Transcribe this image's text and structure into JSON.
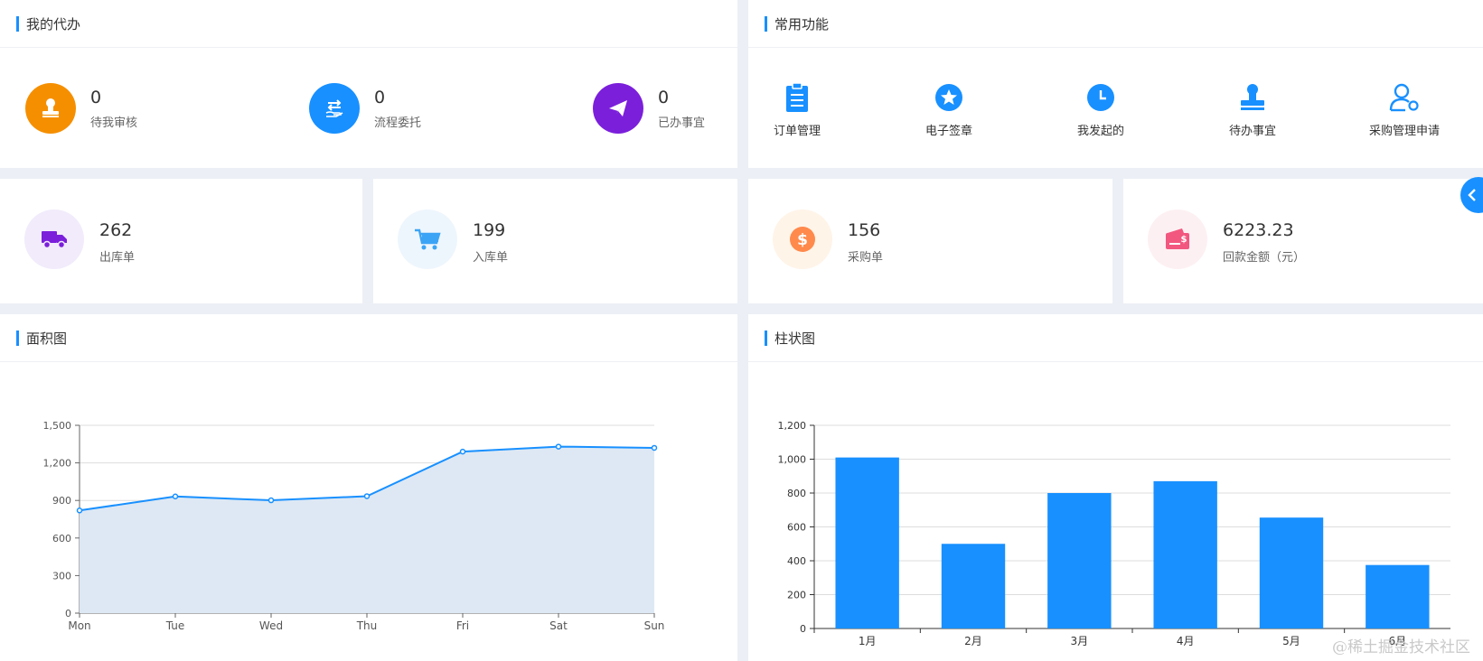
{
  "todo": {
    "title": "我的代办",
    "items": [
      {
        "count": "0",
        "label": "待我审核",
        "icon": "stamp-icon",
        "color": "#f58f00"
      },
      {
        "count": "0",
        "label": "流程委托",
        "icon": "hand-transfer-icon",
        "color": "#1890ff"
      },
      {
        "count": "0",
        "label": "已办事宜",
        "icon": "paper-plane-icon",
        "color": "#7b1fdb"
      }
    ]
  },
  "common": {
    "title": "常用功能",
    "items": [
      {
        "label": "订单管理",
        "icon": "clipboard-icon"
      },
      {
        "label": "电子签章",
        "icon": "star-badge-icon"
      },
      {
        "label": "我发起的",
        "icon": "clock-icon"
      },
      {
        "label": "待办事宜",
        "icon": "stamp-icon"
      },
      {
        "label": "采购管理申请",
        "icon": "user-settings-icon"
      }
    ]
  },
  "stats": [
    {
      "value": "262",
      "label": "出库单",
      "icon": "truck-icon",
      "color": "#7b1fdb",
      "bg": "#f1ebfb"
    },
    {
      "value": "199",
      "label": "入库单",
      "icon": "cart-icon",
      "color": "#3ca4f5",
      "bg": "#eef6fd"
    },
    {
      "value": "156",
      "label": "采购单",
      "icon": "dollar-coin-icon",
      "color": "#ff8a4c",
      "bg": "#fff4e8"
    },
    {
      "value": "6223.23",
      "label": "回款金额（元）",
      "icon": "wallet-icon",
      "color": "#f2577f",
      "bg": "#fdf0f3"
    }
  ],
  "area_chart": {
    "title": "面积图"
  },
  "bar_chart": {
    "title": "柱状图"
  },
  "watermark": "@稀土掘金技术社区",
  "chart_data": [
    {
      "type": "area",
      "title": "面积图",
      "categories": [
        "Mon",
        "Tue",
        "Wed",
        "Thu",
        "Fri",
        "Sat",
        "Sun"
      ],
      "values": [
        820,
        932,
        901,
        934,
        1290,
        1330,
        1320
      ],
      "ylim": [
        0,
        1500
      ],
      "yticks": [
        "0",
        "300",
        "600",
        "900",
        "1,200",
        "1,500"
      ],
      "color": "#1890ff",
      "fill": "#dde8f4"
    },
    {
      "type": "bar",
      "title": "柱状图",
      "categories": [
        "1月",
        "2月",
        "3月",
        "4月",
        "5月",
        "6月"
      ],
      "values": [
        1010,
        500,
        800,
        870,
        655,
        375
      ],
      "ylim": [
        0,
        1200
      ],
      "yticks": [
        "0",
        "200",
        "400",
        "600",
        "800",
        "1,000",
        "1,200"
      ],
      "color": "#1890ff"
    }
  ]
}
